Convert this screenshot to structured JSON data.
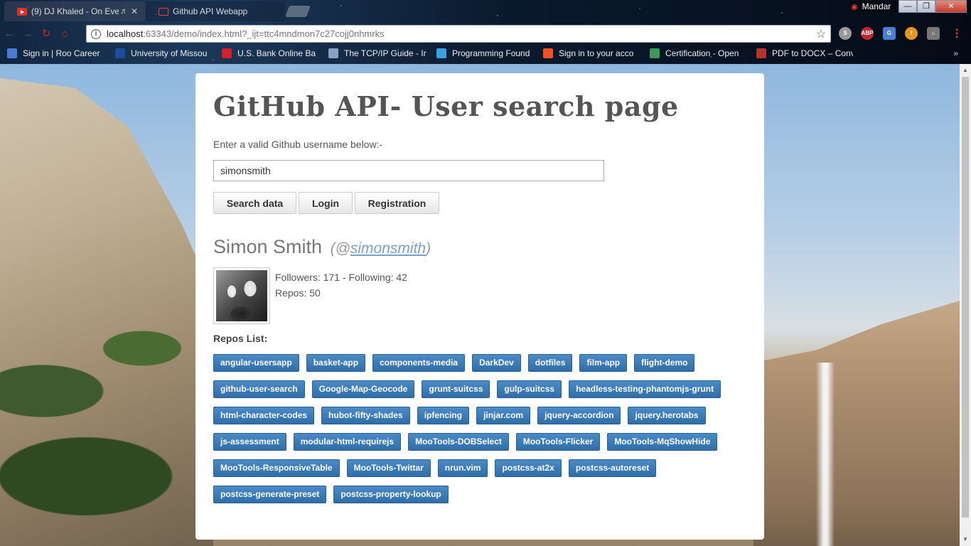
{
  "browser": {
    "tabs": [
      {
        "title": "(9) DJ Khaled - On Eve"
      },
      {
        "title": "Github API Webapp"
      }
    ],
    "profile_name": "Mandar",
    "url_host": "localhost",
    "url_path": ":63343/demo/index.html?_ijt=ttc4mndmon7c27cojj0nhmrks",
    "bookmarks": [
      {
        "label": "Sign in | Roo Career",
        "color": "#4a7bd0"
      },
      {
        "label": "University of Missou",
        "color": "#1a4fa0"
      },
      {
        "label": "U.S. Bank Online Ba",
        "color": "#d21f2b"
      },
      {
        "label": "The TCP/IP Guide - In",
        "color": "#8aa0c0"
      },
      {
        "label": "Programming Found",
        "color": "#3aa0e0"
      },
      {
        "label": "Sign in to your acco",
        "color": "#f25022"
      },
      {
        "label": "Certification - Open",
        "color": "#3a9a5a"
      },
      {
        "label": "PDF to DOCX – Conv",
        "color": "#b3342a"
      }
    ]
  },
  "page": {
    "title": "GitHub API- User search page",
    "prompt": "Enter a valid Github username below:-",
    "search_value": "simonsmith",
    "buttons": {
      "search": "Search data",
      "login": "Login",
      "register": "Registration"
    },
    "user": {
      "name": "Simon Smith",
      "handle_prefix": "(@",
      "handle": "simonsmith",
      "handle_suffix": ")",
      "followers_line": "Followers: 171 - Following: 42",
      "repos_line": "Repos: 50"
    },
    "repos_heading": "Repos List:",
    "repos": [
      "angular-usersapp",
      "basket-app",
      "components-media",
      "DarkDev",
      "dotfiles",
      "film-app",
      "flight-demo",
      "github-user-search",
      "Google-Map-Geocode",
      "grunt-suitcss",
      "gulp-suitcss",
      "headless-testing-phantomjs-grunt",
      "html-character-codes",
      "hubot-fifty-shades",
      "ipfencing",
      "jinjar.com",
      "jquery-accordion",
      "jquery.herotabs",
      "js-assessment",
      "modular-html-requirejs",
      "MooTools-DOBSelect",
      "MooTools-Flicker",
      "MooTools-MqShowHide",
      "MooTools-ResponsiveTable",
      "MooTools-Twittar",
      "nrun.vim",
      "postcss-at2x",
      "postcss-autoreset",
      "postcss-generate-preset",
      "postcss-property-lookup"
    ]
  }
}
